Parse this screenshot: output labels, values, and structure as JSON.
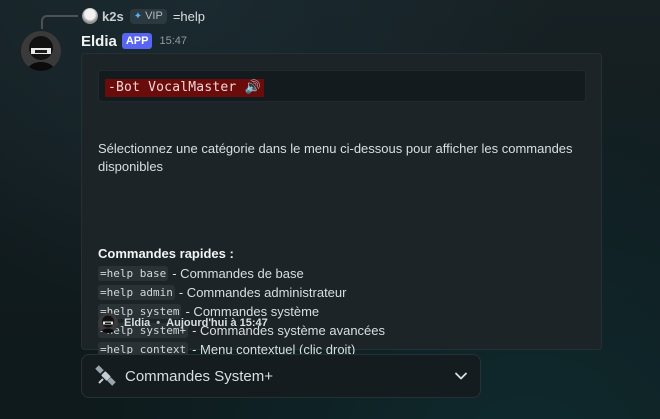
{
  "reply": {
    "username": "k2s",
    "badge_label": "VIP",
    "message": "=help"
  },
  "message": {
    "author": "Eldia",
    "app_badge": "APP",
    "time": "15:47"
  },
  "embed": {
    "title_code": "-Bot VocalMaster 🔊",
    "description": "Sélectionnez une catégorie dans le menu ci-dessous pour afficher les commandes disponibles",
    "quick_title": "Commandes rapides :",
    "commands": [
      {
        "code": "=help base",
        "desc": "- Commandes de base"
      },
      {
        "code": "=help admin",
        "desc": "- Commandes administrateur"
      },
      {
        "code": "=help system",
        "desc": "- Commandes système"
      },
      {
        "code": "=help system+",
        "desc": "- Commandes système avancées"
      },
      {
        "code": "=help context",
        "desc": "- Menu contextuel (clic droit)"
      }
    ],
    "footer_author": "Eldia",
    "footer_separator": "•",
    "footer_time": "Aujourd'hui à 15:47"
  },
  "select_menu": {
    "icon": "satellite-icon",
    "selected": "Commandes System+"
  },
  "colors": {
    "app_badge": "#5865f2",
    "code_highlight_bg": "#6b0c0c"
  }
}
